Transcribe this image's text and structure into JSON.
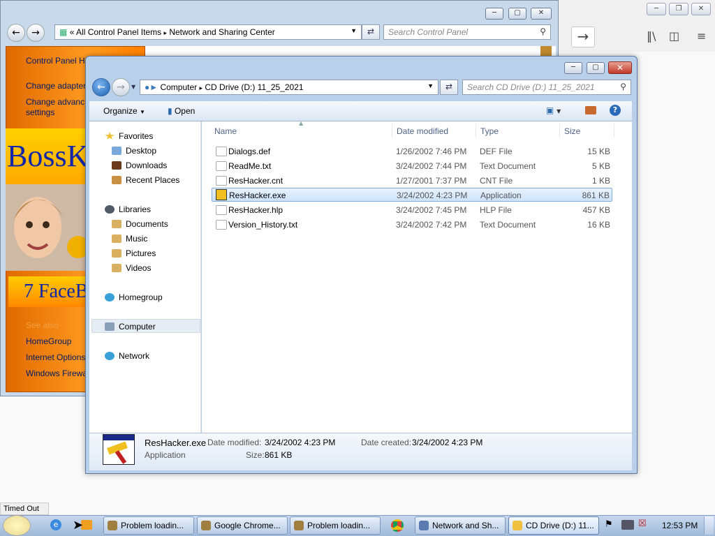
{
  "firefox": {
    "forward_icon": "arrow-right-icon",
    "library_icon": "library-icon",
    "sidebar_icon": "sidebar-icon",
    "menu_icon": "hamburger-menu-icon",
    "status_text": "Timed Out"
  },
  "control_panel": {
    "breadcrumb": [
      "«",
      "All Control Panel Items",
      "▸",
      "Network and Sharing Center"
    ],
    "search_placeholder": "Search Control Panel",
    "side_links": [
      "Control Panel H",
      "Change adapter",
      "Change advanc",
      "settings"
    ],
    "see_also": "See also",
    "bottom_links": [
      "HomeGroup",
      "Internet Options",
      "Windows Firewa"
    ],
    "ad_text_1": "BossK",
    "ad_text_2": "7 FaceB"
  },
  "explorer": {
    "breadcrumb": [
      "Computer",
      "▸",
      "CD Drive (D:) 11_25_2021"
    ],
    "search_placeholder": "Search CD Drive (D:) 11_25_2021",
    "toolbar": {
      "organize": "Organize",
      "open": "Open"
    },
    "nav": {
      "favorites": "Favorites",
      "fav_items": [
        "Desktop",
        "Downloads",
        "Recent Places"
      ],
      "libraries": "Libraries",
      "lib_items": [
        "Documents",
        "Music",
        "Pictures",
        "Videos"
      ],
      "homegroup": "Homegroup",
      "computer": "Computer",
      "network": "Network"
    },
    "columns": {
      "name": "Name",
      "date": "Date modified",
      "type": "Type",
      "size": "Size"
    },
    "files": [
      {
        "name": "Dialogs.def",
        "date": "1/26/2002 7:46 PM",
        "type": "DEF File",
        "size": "15 KB"
      },
      {
        "name": "ReadMe.txt",
        "date": "3/24/2002 7:44 PM",
        "type": "Text Document",
        "size": "5 KB"
      },
      {
        "name": "ResHacker.cnt",
        "date": "1/27/2001 7:37 PM",
        "type": "CNT File",
        "size": "1 KB"
      },
      {
        "name": "ResHacker.exe",
        "date": "3/24/2002 4:23 PM",
        "type": "Application",
        "size": "861 KB"
      },
      {
        "name": "ResHacker.hlp",
        "date": "3/24/2002 7:45 PM",
        "type": "HLP File",
        "size": "457 KB"
      },
      {
        "name": "Version_History.txt",
        "date": "3/24/2002 7:42 PM",
        "type": "Text Document",
        "size": "16 KB"
      }
    ],
    "selected_index": 3,
    "details": {
      "name": "ResHacker.exe",
      "kind": "Application",
      "modified_label": "Date modified:",
      "modified": "3/24/2002 4:23 PM",
      "created_label": "Date created:",
      "created": "3/24/2002 4:23 PM",
      "size_label": "Size:",
      "size": "861 KB"
    }
  },
  "taskbar": {
    "tasks": [
      "Problem loadin...",
      "Google Chrome...",
      "Problem loadin...",
      "Network and Sh...",
      "CD Drive (D:) 11..."
    ],
    "clock": "12:53 PM"
  }
}
